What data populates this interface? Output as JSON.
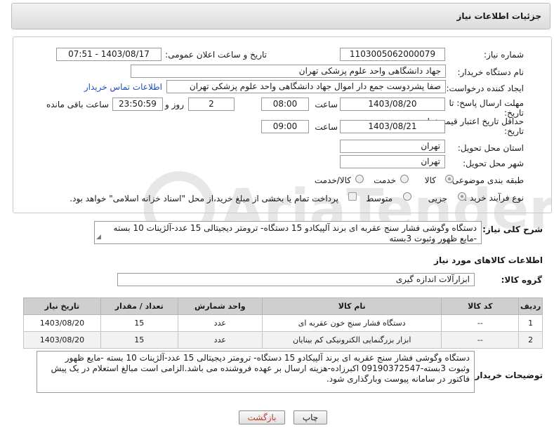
{
  "header": {
    "title": "جزئیات اطلاعات نیاز"
  },
  "form": {
    "need_number_label": "شماره نیاز:",
    "need_number": "1103005062000079",
    "announce_label": "تاریخ و ساعت اعلان عمومی:",
    "announce_value": "1403/08/17 - 07:51",
    "buyer_org_label": "نام دستگاه خریدار:",
    "buyer_org": "جهاد دانشگاهی واحد علوم پزشکی تهران",
    "creator_label": "ایجاد کننده درخواست:",
    "creator": "صفا پشردوست جمع دار اموال  جهاد دانشگاهی واحد علوم پزشکی تهران",
    "contact_link": "اطلاعات تماس خریدار",
    "deadline_label_line1": "مهلت ارسال پاسخ: تا",
    "deadline_label_line2": "تاریخ:",
    "deadline_date": "1403/08/20",
    "time_label": "ساعت",
    "deadline_time": "08:00",
    "days_value": "2",
    "days_label": "روز و",
    "remaining_time": "23:50:59",
    "remaining_label": "ساعت باقی مانده",
    "validity_label_line1": "حداقل تاریخ اعتبار قیمت: تا",
    "validity_label_line2": "تاریخ:",
    "validity_date": "1403/08/21",
    "validity_time_label": "ساعت",
    "validity_time": "09:00",
    "province_label": "استان محل تحویل:",
    "province": "تهران",
    "city_label": "شهر محل تحویل:",
    "city": "تهران",
    "category_label": "طبقه بندی موضوعی:",
    "category_options": [
      "کالا",
      "خدمت",
      "کالا/خدمت"
    ],
    "process_label": "نوع فرآیند خرید :",
    "process_options": [
      "جزیی",
      "متوسط"
    ],
    "treasury_note": "پرداخت تمام یا بخشی از مبلغ خرید،از محل \"اسناد خزانه اسلامی\" خواهد بود."
  },
  "summary": {
    "label": "شرح کلی نیاز:",
    "text": "دستگاه وگوشی فشار سنج عقربه ای برند آلپیکادو 15 دستگاه- ترومتر دیجیتالی 15 عدد-آلژینات 10 بسته -مایع ظهور وثبوت 3بسته"
  },
  "items_section": {
    "title": "اطلاعات کالاهای مورد نیاز",
    "group_label": "گروه کالا:",
    "group_value": "ابزارآلات اندازه گیری",
    "columns": [
      "ردیف",
      "کد کالا",
      "نام کالا",
      "واحد شمارش",
      "تعداد / مقدار",
      "تاریخ نیاز"
    ],
    "rows": [
      {
        "row": "1",
        "code": "--",
        "name": "دستگاه فشار سنج خون عقربه ای",
        "unit": "عدد",
        "qty": "15",
        "date": "1403/08/20"
      },
      {
        "row": "2",
        "code": "--",
        "name": "ابزار بزرگنمایی الکترونیکی کم بینایان",
        "unit": "عدد",
        "qty": "15",
        "date": "1403/08/20"
      }
    ]
  },
  "buyer_notes": {
    "label": "توضیحات خریدار:",
    "text": "دستگاه وگوشی فشار سنج عقربه ای برند آلپیکادو 15 دستگاه- ترومتر دیجیتالی 15 عدد-آلژینات 10 بسته -مایع ظهور وثبوت 3بسته-09190372547 اکبرزاده-هزینه ارسال بر عهده فروشنده می باشد.الزامی است مبالغ استعلام در یک پیش فاکتور در سامانه پیوست وبارگذاری شود."
  },
  "buttons": {
    "print": "چاپ",
    "back": "بازگشت"
  },
  "watermark": {
    "text": "AriaTender.neT"
  }
}
